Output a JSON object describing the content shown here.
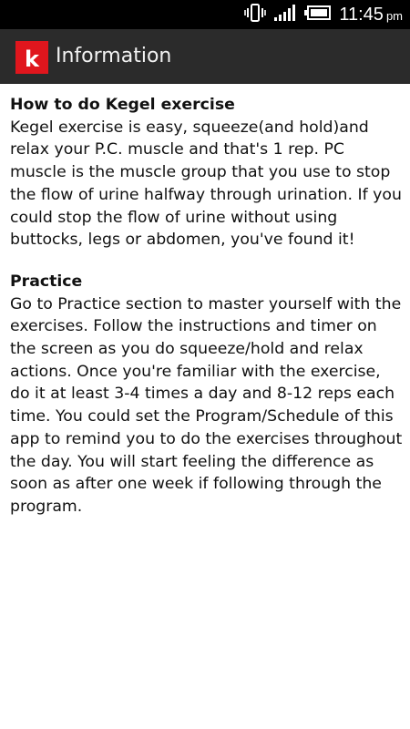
{
  "status_bar": {
    "time": "11:45",
    "ampm": "pm",
    "icons": [
      "vibrate-icon",
      "signal-icon",
      "battery-icon"
    ]
  },
  "app_bar": {
    "logo_letter": "k",
    "title": "Information",
    "logo_color": "#e0161d",
    "background": "#2b2b2b"
  },
  "sections": [
    {
      "title": "How to do Kegel exercise",
      "body": "Kegel exercise is easy, squeeze(and hold)and relax your P.C. muscle and that's 1 rep. PC muscle is the muscle group that you use to stop the flow of urine halfway through urination. If you could stop the flow of urine without using buttocks, legs or abdomen, you've found it!"
    },
    {
      "title": "Practice",
      "body": "Go to Practice section to master yourself with the exercises. Follow the instructions and timer on the screen as you do squeeze/hold and relax actions. Once you're familiar with the exercise, do it at least 3-4 times a day and 8-12 reps each time. You could set the Program/Schedule of this app to remind you to do the exercises throughout the day. You will start feeling the difference as soon as after one week if following through the program."
    }
  ]
}
